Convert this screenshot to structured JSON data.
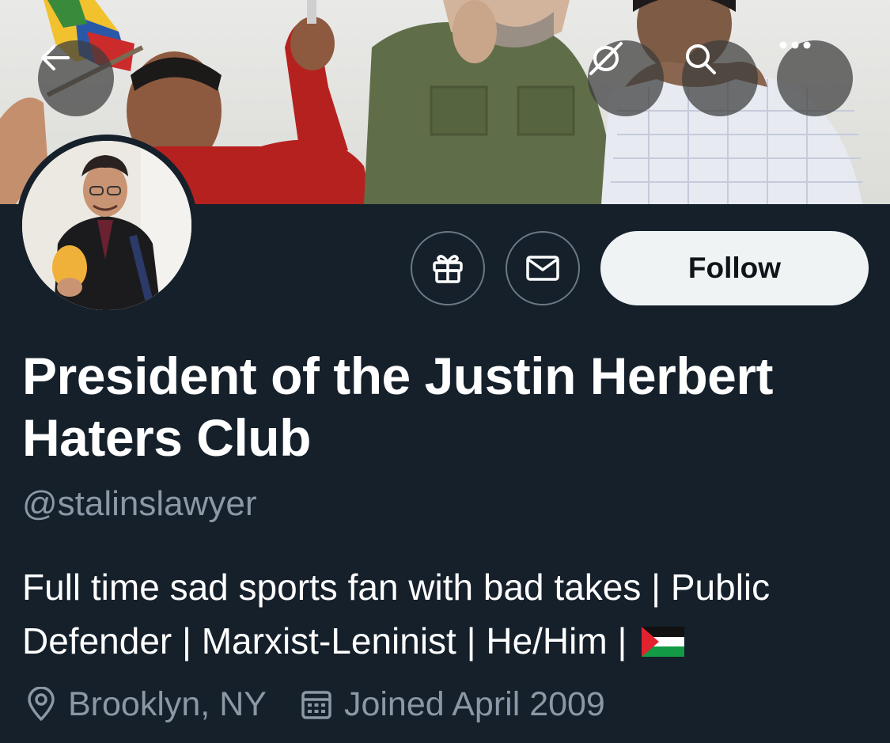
{
  "profile": {
    "display_name": "President of the Justin Herbert Haters Club",
    "handle": "@stalinslawyer",
    "bio_text": "Full time sad sports fan with bad takes | Public Defender | Marxist-Leninist | He/Him | ",
    "bio_flag": "palestine-flag",
    "location": "Brooklyn, NY",
    "joined": "Joined April 2009"
  },
  "actions": {
    "follow_label": "Follow"
  },
  "icons": {
    "back": "arrow-left-icon",
    "grok": "grok-icon",
    "search": "search-icon",
    "more": "more-icon",
    "gift": "gift-icon",
    "message": "envelope-icon",
    "location": "location-pin-icon",
    "calendar": "calendar-icon"
  },
  "colors": {
    "background": "#15202b",
    "text": "#ffffff",
    "secondary_text": "#8b98a5",
    "follow_bg": "#eff3f4",
    "follow_text": "#0f1419"
  }
}
